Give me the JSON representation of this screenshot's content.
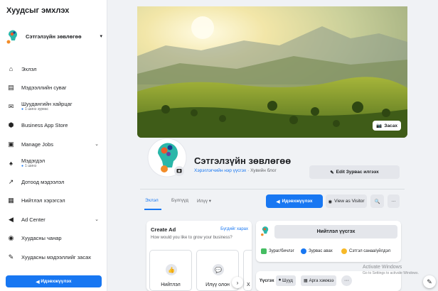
{
  "sidebar": {
    "title": "Хуудсыг эмхлэх",
    "page_name": "Сэтгэлзүйн зөвлөгөө",
    "page_caret": "▾",
    "items": [
      {
        "label": "Эхлэл",
        "icon": "home-icon",
        "glyph": "⌂"
      },
      {
        "label": "Мэдээллийн суваг",
        "icon": "feed-icon",
        "glyph": "▤"
      },
      {
        "label": "Шуудангийн хайрцаг",
        "sub": "1 шинэ зурвас",
        "icon": "inbox-icon",
        "glyph": "✉"
      },
      {
        "label": "Business App Store",
        "icon": "app-store-icon",
        "glyph": "⬢"
      },
      {
        "label": "Manage Jobs",
        "icon": "briefcase-icon",
        "glyph": "▣",
        "chevron": "⌄"
      },
      {
        "label": "Мэдэгдэл",
        "sub": "1 шинэ",
        "icon": "bell-icon",
        "glyph": "♠"
      },
      {
        "label": "Дотоод мэдээлэл",
        "icon": "insights-icon",
        "glyph": "↗"
      },
      {
        "label": "Нийтлэл хэрэгсэл",
        "icon": "publishing-tools-icon",
        "glyph": "▦"
      },
      {
        "label": "Ad Center",
        "icon": "megaphone-icon",
        "glyph": "◀",
        "chevron": "⌄"
      },
      {
        "label": "Хуудасны чанар",
        "icon": "page-quality-icon",
        "glyph": "◉"
      },
      {
        "label": "Хуудасны мэдээллийг засах",
        "icon": "pencil-icon",
        "glyph": "✎"
      }
    ],
    "promote_label": "Идэвхжүүлэх"
  },
  "cover": {
    "edit_label": "Засах"
  },
  "profile": {
    "name": "Сэтгэлзүйн зөвлөгөө",
    "category_link": "Хэрэглэгчийн нэр үүсгэх",
    "category_sep": " · ",
    "category": "Хувийн блог",
    "edit_info_label": "Edit Зурвас илгээх"
  },
  "tabs": [
    {
      "label": "Эхлэл",
      "active": true
    },
    {
      "label": "Бүлгүүд",
      "active": false
    },
    {
      "label": "Илүү ▾",
      "active": false
    }
  ],
  "actions": {
    "promote": "Идэвхжүүлэх",
    "view_as_visitor": "View as Visitor",
    "search": "🔍",
    "more": "···"
  },
  "create_ad": {
    "title": "Create Ad",
    "link": "Бүгдийг харах",
    "subtitle": "How would you like to grow your business?",
    "tiles": [
      {
        "label": "Нийтлэл",
        "icon": "thumbs-up-icon",
        "glyph": "👍"
      },
      {
        "label": "Илүү олон",
        "icon": "messenger-icon",
        "glyph": "💬"
      },
      {
        "label": "Х",
        "icon": "more-icon",
        "glyph": "·"
      }
    ],
    "next": "›"
  },
  "create_post": {
    "button": "Нийтлэл үүсгэх",
    "actions": [
      {
        "label": "Зураг/бичлэг",
        "color": "#45bd62"
      },
      {
        "label": "Зурвас авах",
        "color": "#1877f2"
      },
      {
        "label": "Сэтгэл санаа/үйлдэл",
        "color": "#f7b928"
      }
    ]
  },
  "filters": {
    "label": "Үүсгэх",
    "chips": [
      {
        "label": "Шууд",
        "icon": "live-icon",
        "glyph": "⏺"
      },
      {
        "label": "Арга хэмжээ",
        "icon": "event-icon",
        "glyph": "▦"
      }
    ],
    "more": "···"
  },
  "watermark": {
    "line1": "Activate Windows",
    "line2": "Go to Settings to activate Windows."
  },
  "floating_edit": "✎"
}
